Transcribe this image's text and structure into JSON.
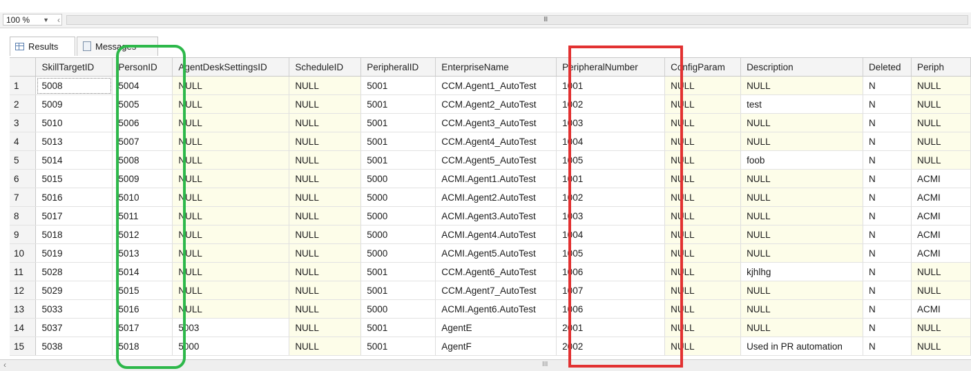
{
  "toolbar": {
    "zoom": "100 %",
    "grip": "III"
  },
  "tabs": [
    {
      "label": "Results"
    },
    {
      "label": "Messages"
    }
  ],
  "columns": [
    "",
    "SkillTargetID",
    "PersonID",
    "AgentDeskSettingsID",
    "ScheduleID",
    "PeripheralID",
    "EnterpriseName",
    "PeripheralNumber",
    "ConfigParam",
    "Description",
    "Deleted",
    "Periph"
  ],
  "rows": [
    [
      "1",
      "5008",
      "5004",
      "NULL",
      "NULL",
      "5001",
      "CCM.Agent1_AutoTest",
      "1001",
      "NULL",
      "NULL",
      "N",
      "NULL"
    ],
    [
      "2",
      "5009",
      "5005",
      "NULL",
      "NULL",
      "5001",
      "CCM.Agent2_AutoTest",
      "1002",
      "NULL",
      "test",
      "N",
      "NULL"
    ],
    [
      "3",
      "5010",
      "5006",
      "NULL",
      "NULL",
      "5001",
      "CCM.Agent3_AutoTest",
      "1003",
      "NULL",
      "NULL",
      "N",
      "NULL"
    ],
    [
      "4",
      "5013",
      "5007",
      "NULL",
      "NULL",
      "5001",
      "CCM.Agent4_AutoTest",
      "1004",
      "NULL",
      "NULL",
      "N",
      "NULL"
    ],
    [
      "5",
      "5014",
      "5008",
      "NULL",
      "NULL",
      "5001",
      "CCM.Agent5_AutoTest",
      "1005",
      "NULL",
      "foob",
      "N",
      "NULL"
    ],
    [
      "6",
      "5015",
      "5009",
      "NULL",
      "NULL",
      "5000",
      "ACMI.Agent1.AutoTest",
      "1001",
      "NULL",
      "NULL",
      "N",
      "ACMI"
    ],
    [
      "7",
      "5016",
      "5010",
      "NULL",
      "NULL",
      "5000",
      "ACMI.Agent2.AutoTest",
      "1002",
      "NULL",
      "NULL",
      "N",
      "ACMI"
    ],
    [
      "8",
      "5017",
      "5011",
      "NULL",
      "NULL",
      "5000",
      "ACMI.Agent3.AutoTest",
      "1003",
      "NULL",
      "NULL",
      "N",
      "ACMI"
    ],
    [
      "9",
      "5018",
      "5012",
      "NULL",
      "NULL",
      "5000",
      "ACMI.Agent4.AutoTest",
      "1004",
      "NULL",
      "NULL",
      "N",
      "ACMI"
    ],
    [
      "10",
      "5019",
      "5013",
      "NULL",
      "NULL",
      "5000",
      "ACMI.Agent5.AutoTest",
      "1005",
      "NULL",
      "NULL",
      "N",
      "ACMI"
    ],
    [
      "11",
      "5028",
      "5014",
      "NULL",
      "NULL",
      "5001",
      "CCM.Agent6_AutoTest",
      "1006",
      "NULL",
      "kjhlhg",
      "N",
      "NULL"
    ],
    [
      "12",
      "5029",
      "5015",
      "NULL",
      "NULL",
      "5001",
      "CCM.Agent7_AutoTest",
      "1007",
      "NULL",
      "NULL",
      "N",
      "NULL"
    ],
    [
      "13",
      "5033",
      "5016",
      "NULL",
      "NULL",
      "5000",
      "ACMI.Agent6.AutoTest",
      "1006",
      "NULL",
      "NULL",
      "N",
      "ACMI"
    ],
    [
      "14",
      "5037",
      "5017",
      "5003",
      "NULL",
      "5001",
      "AgentE",
      "2001",
      "NULL",
      "NULL",
      "N",
      "NULL"
    ],
    [
      "15",
      "5038",
      "5018",
      "5000",
      "NULL",
      "5001",
      "AgentF",
      "2002",
      "NULL",
      "Used in PR automation",
      "N",
      "NULL"
    ]
  ],
  "colors": {
    "green_highlight": "#2db84a",
    "red_highlight": "#e23131",
    "null_cell": "#fdfde9"
  }
}
